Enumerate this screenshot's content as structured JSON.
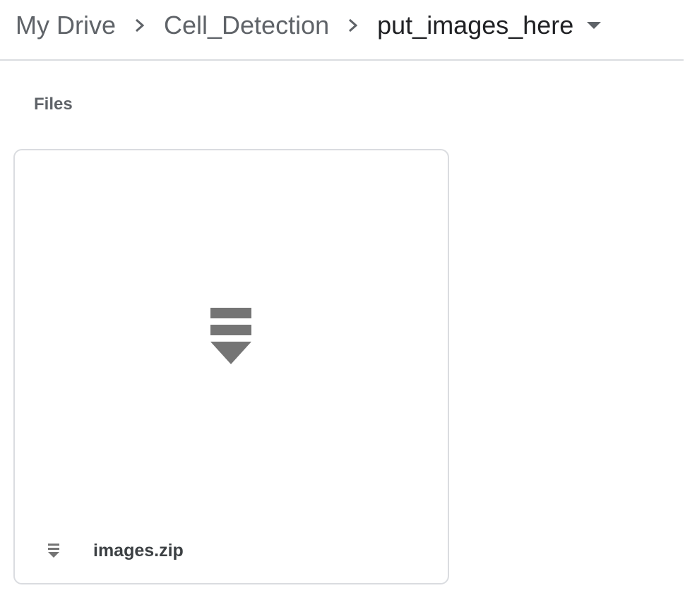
{
  "breadcrumb": {
    "items": [
      {
        "label": "My Drive"
      },
      {
        "label": "Cell_Detection"
      },
      {
        "label": "put_images_here"
      }
    ],
    "separator_icon": "chevron-right-icon",
    "dropdown_icon": "caret-down-icon"
  },
  "section": {
    "label": "Files"
  },
  "files": [
    {
      "name": "images.zip",
      "type_icon": "archive-zip-icon"
    }
  ],
  "colors": {
    "icon_gray": "#757575",
    "divider": "#dadce0",
    "text_primary": "#202124",
    "text_secondary": "#5f6368"
  }
}
